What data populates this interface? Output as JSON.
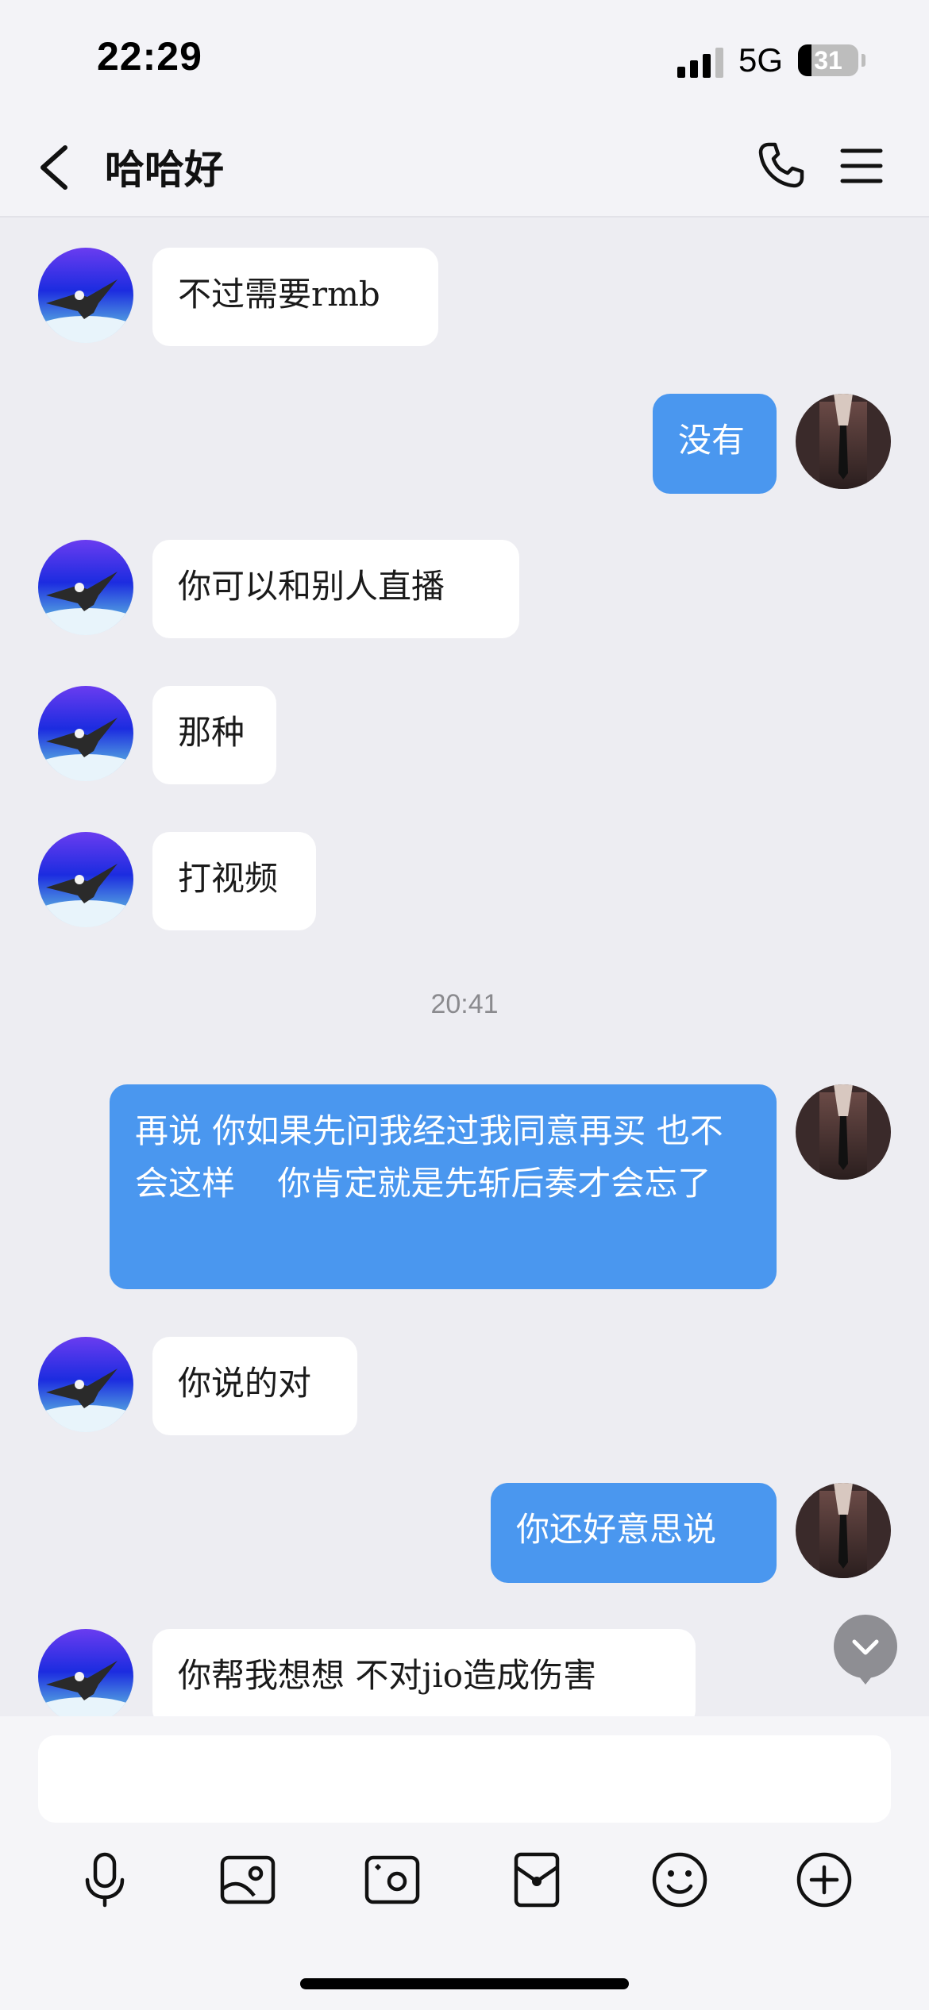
{
  "status_bar": {
    "time": "22:29",
    "network": "5G",
    "battery": "31"
  },
  "header": {
    "title": "哈哈好"
  },
  "messages": [
    {
      "side": "in",
      "text": "不过需要rmb"
    },
    {
      "side": "out",
      "text": "没有"
    },
    {
      "side": "in",
      "text": "你可以和别人直播"
    },
    {
      "side": "in",
      "text": "那种"
    },
    {
      "side": "in",
      "text": "打视频"
    },
    {
      "side": "out",
      "text": "再说 你如果先问我经过我同意再买 也不会这样    你肯定就是先斩后奏才会忘了"
    },
    {
      "side": "in",
      "text": "你说的对"
    },
    {
      "side": "out",
      "text": "你还好意思说"
    },
    {
      "side": "in",
      "text": "你帮我想想 不对jio造成伤害"
    }
  ],
  "timestamp": "20:41",
  "input": {
    "placeholder": ""
  },
  "toolbar": [
    "microphone-icon",
    "photo-album-icon",
    "camera-icon",
    "red-packet-icon",
    "emoji-icon",
    "plus-icon"
  ],
  "colors": {
    "outgoing_bubble": "#4a97ef",
    "incoming_bubble": "#ffffff",
    "background": "#ededf2"
  }
}
